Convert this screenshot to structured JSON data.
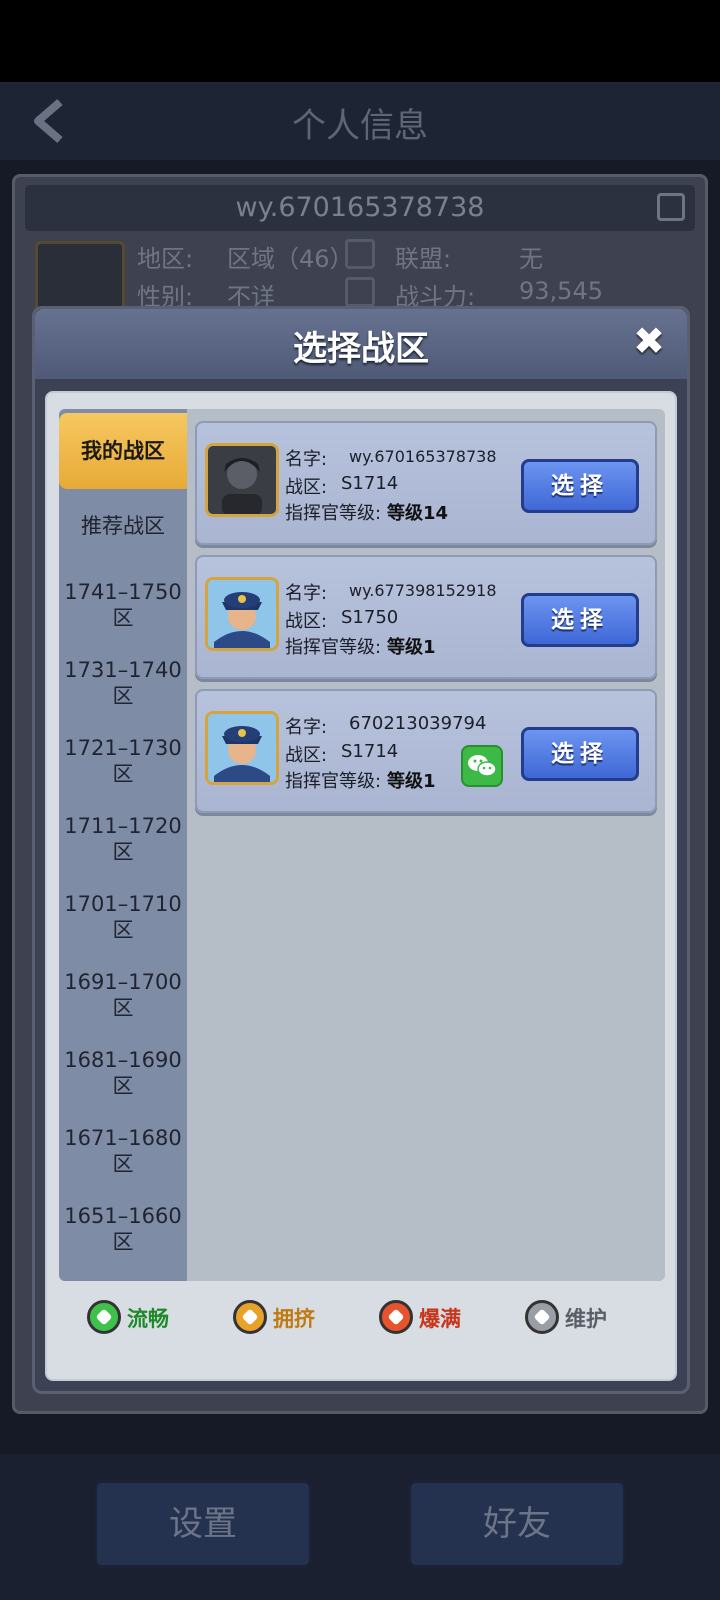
{
  "background": {
    "header_title": "个人信息",
    "player_id": "wy.670165378738",
    "region_label": "地区:",
    "region_value": "区域（46）",
    "alliance_label": "联盟:",
    "alliance_value": "无",
    "gender_label": "性别:",
    "gender_value": "不详",
    "power_label": "战斗力:",
    "power_value": "93,545",
    "settings_button": "设置",
    "friends_button": "好友"
  },
  "modal": {
    "title": "选择战区",
    "close_icon": "close-icon",
    "sidebar": {
      "active": "我的战区",
      "items": [
        {
          "line1": "推荐战区",
          "line2": ""
        },
        {
          "line1": "1741–1750",
          "line2": "区"
        },
        {
          "line1": "1731–1740",
          "line2": "区"
        },
        {
          "line1": "1721–1730",
          "line2": "区"
        },
        {
          "line1": "1711–1720",
          "line2": "区"
        },
        {
          "line1": "1701–1710",
          "line2": "区"
        },
        {
          "line1": "1691–1700",
          "line2": "区"
        },
        {
          "line1": "1681–1690",
          "line2": "区"
        },
        {
          "line1": "1671–1680",
          "line2": "区"
        },
        {
          "line1": "1651–1660",
          "line2": "区"
        }
      ]
    },
    "servers": [
      {
        "name_label": "名字:",
        "name": "wy.670165378738",
        "zone_label": "战区:",
        "zone": "S1714",
        "level_label": "指挥官等级:",
        "level": "等级14",
        "button": "选择",
        "wechat": false
      },
      {
        "name_label": "名字:",
        "name": "wy.677398152918",
        "zone_label": "战区:",
        "zone": "S1750",
        "level_label": "指挥官等级:",
        "level": "等级1",
        "button": "选择",
        "wechat": false
      },
      {
        "name_label": "名字:",
        "name": "670213039794",
        "zone_label": "战区:",
        "zone": "S1714",
        "level_label": "指挥官等级:",
        "level": "等级1",
        "button": "选择",
        "wechat": true
      }
    ],
    "legend": [
      {
        "label": "流畅",
        "color": "#3fc24a"
      },
      {
        "label": "拥挤",
        "color": "#e8a22a"
      },
      {
        "label": "爆满",
        "color": "#e8532e"
      },
      {
        "label": "维护",
        "color": "#9a9ea6"
      }
    ]
  }
}
